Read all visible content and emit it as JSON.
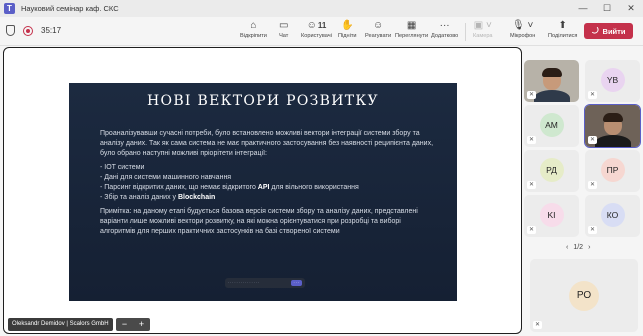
{
  "window": {
    "title": "Науковий семінар каф. СКС",
    "app_icon": "teams-icon"
  },
  "meeting": {
    "timer": "35:17"
  },
  "toolbar": {
    "share_label": "Відкріпити",
    "chat_label": "Чат",
    "people_count": "11",
    "people_label": "Користувачі",
    "raise_label": "Підніти",
    "react_label": "Реагувати",
    "view_label": "Переглянути",
    "apps_label": "Додатково",
    "camera_label": "Камера",
    "mic_label": "Мікрофон",
    "share_screen_label": "Поділитися",
    "leave_label": "Вийти"
  },
  "slide": {
    "title": "НОВІ ВЕКТОРИ РОЗВИТКУ",
    "intro": "Проаналізувавши сучасні потреби, було встановлено можливі вектори інтеграції системи збору та аналізу даних. Так як сама система не має практичного застосування без наявності реципієнта даних, було обрано наступні можливі пріорітети інтеграції:",
    "bullets": [
      {
        "text": "- IOT системи",
        "bold": ""
      },
      {
        "text": "- Дані для системи машинного навчання",
        "bold": ""
      },
      {
        "text": "- Парсинг відкритих даних, що немає відкритого ",
        "bold": "API",
        "after": " для вільного використання"
      },
      {
        "text": "- Збір та аналіз даних у ",
        "bold": "Blockchain",
        "after": ""
      }
    ],
    "note": "Примітка: на даному етапі будується базова версія системи збору та аналізу даних, представлені варіанти лише можливі вектори розвитку, на які можна орієнтуватися при розробці та виборі алгоритмів для перших практичних застосунків на базі створеної системи"
  },
  "stage": {
    "presenter": "Oleksandr Demidov | Scalors GmbH"
  },
  "participants": [
    {
      "initials": "",
      "video": true,
      "label": "participant-video-1"
    },
    {
      "initials": "YB",
      "color": "#e9d4f0"
    },
    {
      "initials": "AM",
      "color": "#cfe8cf"
    },
    {
      "initials": "",
      "video": true,
      "label": "participant-video-2"
    },
    {
      "initials": "РД",
      "color": "#e6ecc8"
    },
    {
      "initials": "ПР",
      "color": "#f6d7d1"
    },
    {
      "initials": "KI",
      "color": "#f7dcea"
    },
    {
      "initials": "КО",
      "color": "#d8ddf4"
    }
  ],
  "pager": {
    "text": "1/2"
  },
  "big_tile": {
    "initials": "РО",
    "color": "#f3e3c9"
  }
}
